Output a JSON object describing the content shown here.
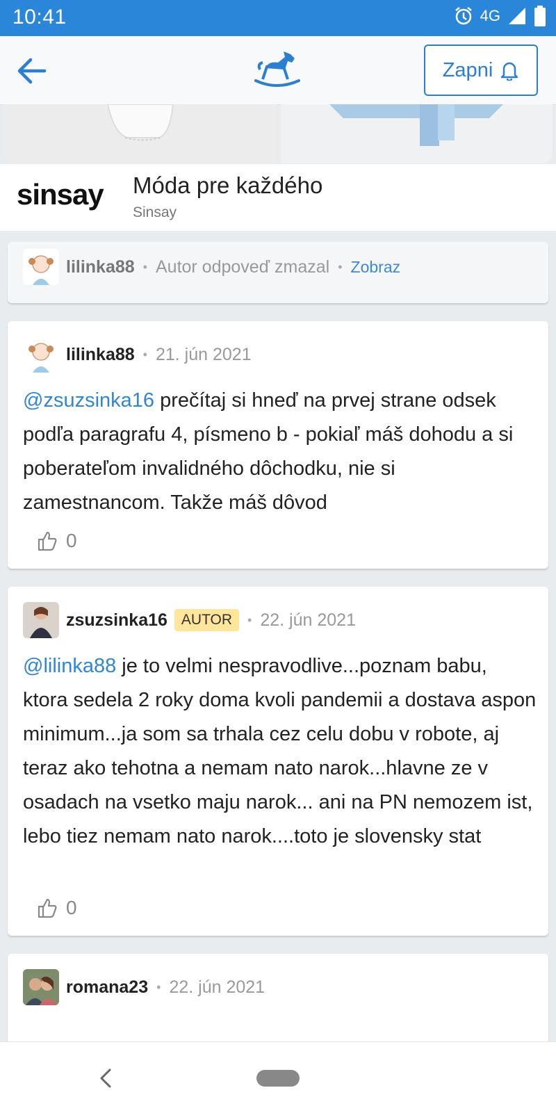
{
  "status": {
    "time": "10:41",
    "network": "4G"
  },
  "header": {
    "notify_label": "Zapni"
  },
  "ad": {
    "brand": "sinsay",
    "headline": "Móda pre každého",
    "sponsor": "Sinsay"
  },
  "comments": [
    {
      "user": "lilinka88",
      "deleted_text": "Autor odpoveď zmazal",
      "show_label": "Zobraz"
    },
    {
      "user": "lilinka88",
      "date": "21. jún 2021",
      "mention": "@zsuzsinka16",
      "text": " prečítaj si hneď na prvej strane odsek podľa paragrafu 4, písmeno b - pokiaľ máš dohodu a si poberateľom invalidného dôchodku, nie si zamestnancom. Takže máš dôvod",
      "likes": "0"
    },
    {
      "user": "zsuzsinka16",
      "badge": "AUTOR",
      "date": "22. jún 2021",
      "mention": "@lilinka88",
      "text": " je to velmi nespravodlive...poznam babu, ktora sedela 2 roky doma kvoli pandemii a dostava aspon minimum...ja som sa trhala cez celu dobu v robote, aj teraz ako tehotna a nemam nato narok...hlavne ze v osadach na vsetko maju narok... ani na PN nemozem ist, lebo tiez nemam nato narok....toto je slovensky stat",
      "likes": "0"
    },
    {
      "user": "romana23",
      "date": "22. jún 2021"
    }
  ],
  "colors": {
    "primary": "#2a86d8",
    "mention": "#2f86d8",
    "badge": "#ffe69a"
  }
}
